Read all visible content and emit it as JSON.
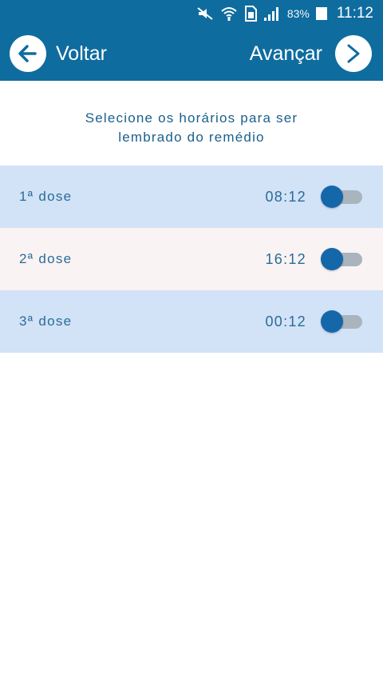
{
  "status_bar": {
    "battery_percent": "83%",
    "time": "11:12",
    "icons": [
      "mute-icon",
      "wifi-icon",
      "sim-icon",
      "signal-icon",
      "battery-icon"
    ]
  },
  "app_bar": {
    "back_label": "Voltar",
    "next_label": "Avançar",
    "color": "#0f6c9f"
  },
  "instruction": {
    "line1": "Selecione os horários para ser",
    "line2": "lembrado do remédio"
  },
  "doses": [
    {
      "label": "1ª dose",
      "time": "08:12",
      "enabled": false
    },
    {
      "label": "2ª dose",
      "time": "16:12",
      "enabled": false
    },
    {
      "label": "3ª dose",
      "time": "00:12",
      "enabled": false
    }
  ],
  "colors": {
    "accent": "#1467a9",
    "row_blue": "#d2e2f7",
    "row_pink": "#f9f3f3",
    "text": "#2a6c98"
  }
}
